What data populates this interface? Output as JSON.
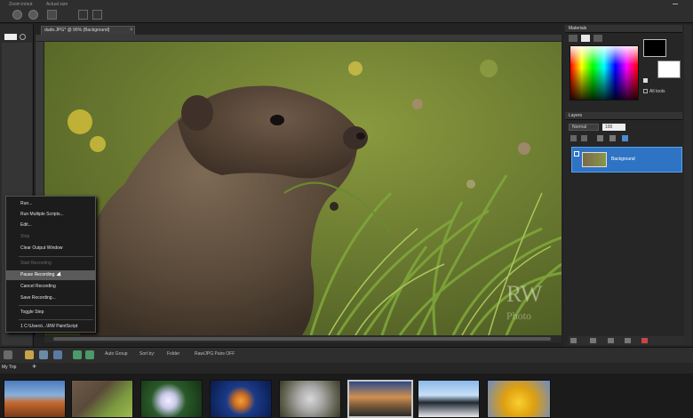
{
  "topbar": {
    "label_zoom": "Zoom in/out",
    "label_actual": "Actual size"
  },
  "document": {
    "tab_title": "dude.JPG* @ 96% (Background)"
  },
  "context_menu": {
    "items": [
      {
        "label": "Run...",
        "disabled": false,
        "highlighted": false
      },
      {
        "label": "Run Multiple Scripts...",
        "disabled": false,
        "highlighted": false
      },
      {
        "label": "Edit...",
        "disabled": false,
        "highlighted": false
      },
      {
        "label": "Stop",
        "disabled": true,
        "highlighted": false
      },
      {
        "label": "Clear Output Window",
        "disabled": false,
        "highlighted": false
      },
      {
        "label": "Start Recording",
        "disabled": true,
        "highlighted": false
      },
      {
        "label": "Pause Recording",
        "disabled": false,
        "highlighted": true
      },
      {
        "label": "Cancel Recording",
        "disabled": false,
        "highlighted": false
      },
      {
        "label": "Save Recording...",
        "disabled": false,
        "highlighted": false
      },
      {
        "label": "Toggle Step",
        "disabled": false,
        "highlighted": false
      },
      {
        "label": "1 C:\\Users\\...\\RW PaintScript",
        "disabled": false,
        "highlighted": false
      }
    ]
  },
  "materials": {
    "title": "Materials",
    "all_tools_label": "All tools"
  },
  "layers": {
    "title": "Layers",
    "blend_mode": "Normal",
    "opacity": "100",
    "layer_name": "Background"
  },
  "watermark": {
    "line1": "RW",
    "line2": "Photo"
  },
  "organizer": {
    "auto_group": "Auto Group",
    "sort_by": "Sort by:",
    "folder": "Folder",
    "filter": "Raw/JPG Pairs OFF",
    "trip_label": "My Trip"
  },
  "colors": {
    "selection": "#2f74c4",
    "menu_highlight": "#5a5a5a",
    "panel_bg": "#262626"
  }
}
